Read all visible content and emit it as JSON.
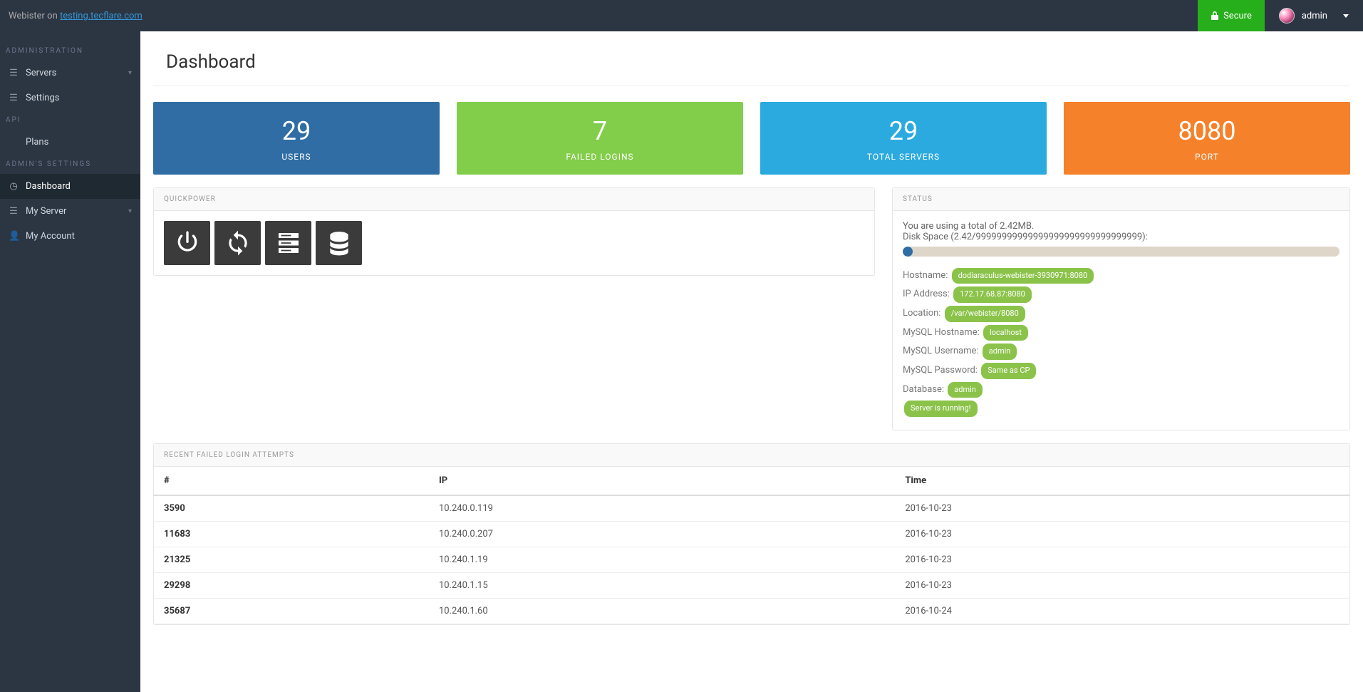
{
  "header": {
    "brand_prefix": "Webister on ",
    "brand_host": "testing.tecflare.com",
    "secure_label": "Secure",
    "username": "admin"
  },
  "sidebar": {
    "section_admin": "ADMINISTRATION",
    "section_api": "API",
    "section_admins": "ADMIN'S SETTINGS",
    "items": {
      "servers": "Servers",
      "settings": "Settings",
      "plans": "Plans",
      "dashboard": "Dashboard",
      "myserver": "My Server",
      "myaccount": "My Account"
    }
  },
  "page": {
    "title": "Dashboard"
  },
  "cards": [
    {
      "value": "29",
      "label": "USERS"
    },
    {
      "value": "7",
      "label": "FAILED LOGINS"
    },
    {
      "value": "29",
      "label": "TOTAL SERVERS"
    },
    {
      "value": "8080",
      "label": "PORT"
    }
  ],
  "panels": {
    "quickpower_title": "QUICKPOWER",
    "status_title": "STATUS",
    "logins_title": "RECENT FAILED LOGIN ATTEMPTS"
  },
  "status": {
    "usage_line": "You are using a total of 2.42MB.",
    "disk_line": "Disk Space (2.42/99999999999999999999999999999999):",
    "labels": {
      "hostname": "Hostname:",
      "ip": "IP Address:",
      "location": "Location:",
      "mysql_host": "MySQL Hostname:",
      "mysql_user": "MySQL Username:",
      "mysql_pass": "MySQL Password:",
      "database": "Database:"
    },
    "values": {
      "hostname": "dodiaraculus-webister-3930971:8080",
      "ip": "172.17.68.87:8080",
      "location": "/var/webister/8080",
      "mysql_host": "localhost",
      "mysql_user": "admin",
      "mysql_pass": "Same as CP",
      "database": "admin",
      "server_running": "Server is running!"
    }
  },
  "logins": {
    "head": {
      "id": "#",
      "ip": "IP",
      "time": "Time"
    },
    "rows": [
      {
        "id": "3590",
        "ip": "10.240.0.119",
        "time": "2016-10-23"
      },
      {
        "id": "11683",
        "ip": "10.240.0.207",
        "time": "2016-10-23"
      },
      {
        "id": "21325",
        "ip": "10.240.1.19",
        "time": "2016-10-23"
      },
      {
        "id": "29298",
        "ip": "10.240.1.15",
        "time": "2016-10-23"
      },
      {
        "id": "35687",
        "ip": "10.240.1.60",
        "time": "2016-10-24"
      }
    ]
  }
}
